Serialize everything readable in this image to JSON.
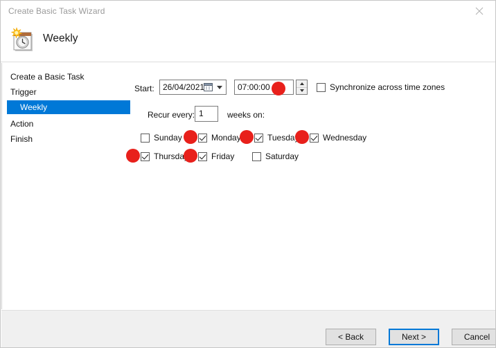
{
  "window": {
    "title": "Create Basic Task Wizard",
    "close_icon": "close-icon"
  },
  "header": {
    "title": "Weekly",
    "icon": "weekly-trigger-clock-calendar-icon"
  },
  "sidebar": {
    "items": [
      {
        "label": "Create a Basic Task",
        "selected": false,
        "indent": false
      },
      {
        "label": "Trigger",
        "selected": false,
        "indent": false
      },
      {
        "label": "Weekly",
        "selected": true,
        "indent": true
      },
      {
        "label": "Action",
        "selected": false,
        "indent": false
      },
      {
        "label": "Finish",
        "selected": false,
        "indent": false
      }
    ],
    "selected_bg": "#0078d7"
  },
  "main": {
    "start_label": "Start:",
    "date_value": "26/04/2021",
    "time_value": "07:00:00",
    "sync_label": "Synchronize across time zones",
    "sync_checked": false,
    "recur_label": "Recur every:",
    "recur_value": "1",
    "weeks_on_label": "weeks on:",
    "days": [
      {
        "label": "Sunday",
        "checked": false
      },
      {
        "label": "Monday",
        "checked": true
      },
      {
        "label": "Tuesday",
        "checked": true
      },
      {
        "label": "Wednesday",
        "checked": true
      },
      {
        "label": "Thursday",
        "checked": true
      },
      {
        "label": "Friday",
        "checked": true
      },
      {
        "label": "Saturday",
        "checked": false
      }
    ]
  },
  "annotations": {
    "color": "#e8201b",
    "count": 6,
    "targets": [
      "time-field",
      "monday-checkbox",
      "tuesday-checkbox",
      "wednesday-checkbox",
      "thursday-checkbox",
      "friday-checkbox"
    ]
  },
  "footer": {
    "back_label": "< Back",
    "next_label": "Next >",
    "cancel_label": "Cancel",
    "default_button": "Next >",
    "focus_color": "#0078d7"
  }
}
